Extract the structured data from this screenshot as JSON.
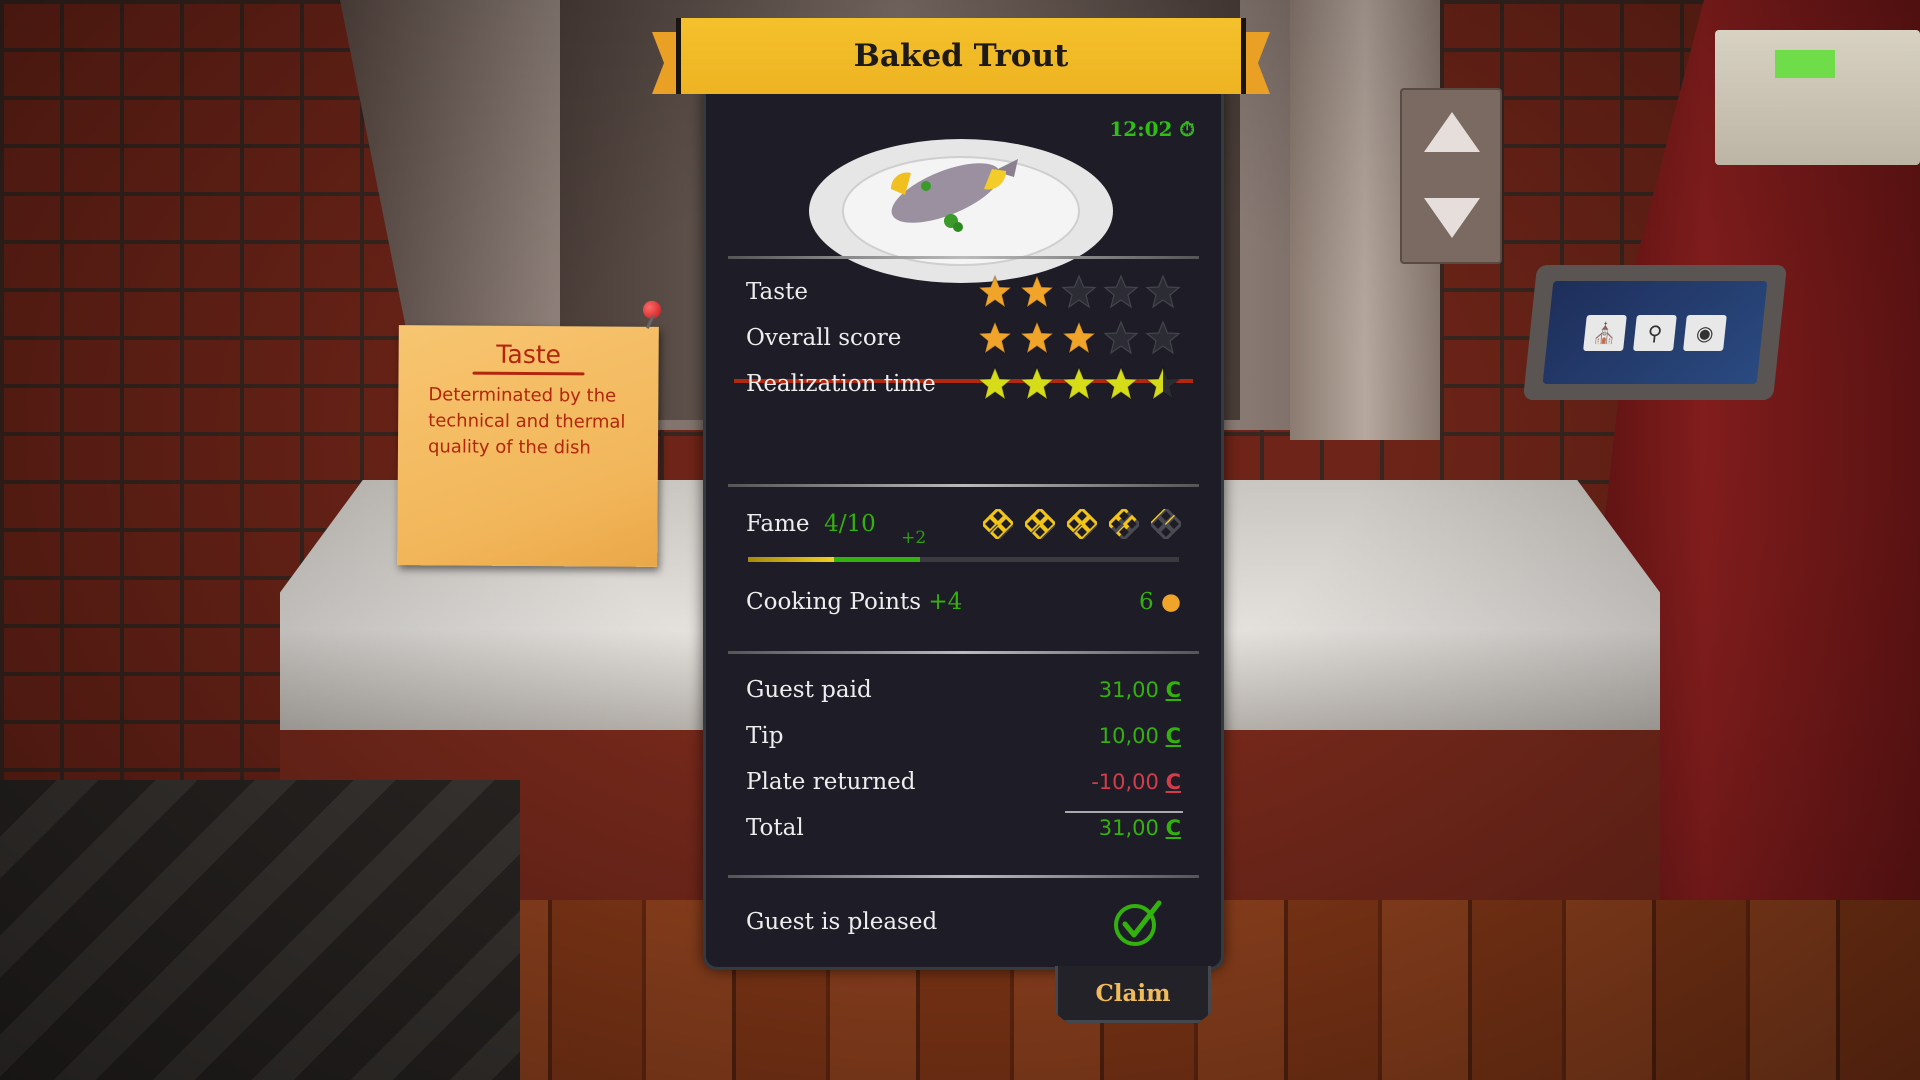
{
  "dish": {
    "title": "Baked Trout",
    "timer": "12:02",
    "timer_icon": "stopwatch-icon",
    "image": "plate-with-baked-trout"
  },
  "ratings": [
    {
      "label": "Taste",
      "stars": 2,
      "max": 5,
      "color": "#f0a42a",
      "highlighted": true
    },
    {
      "label": "Overall score",
      "stars": 3,
      "max": 5,
      "color": "#f0a42a",
      "highlighted": false
    },
    {
      "label": "Realization time",
      "stars": 4.5,
      "max": 5,
      "color": "#d6dc18",
      "highlighted": false
    }
  ],
  "fame": {
    "label": "Fame",
    "value_text": "4/10",
    "previous": 2,
    "current": 4,
    "max": 10,
    "delta_text": "+2",
    "icons_filled": 3.5,
    "icons_max": 5,
    "icon": "fame-knot-icon"
  },
  "cooking_points": {
    "label": "Cooking Points",
    "delta_text": "+4",
    "total": "6",
    "icon": "chef-hat-icon"
  },
  "payment": {
    "rows": [
      {
        "label": "Guest paid",
        "amount": "31,00",
        "currency": "C",
        "status": "positive"
      },
      {
        "label": "Tip",
        "amount": "10,00",
        "currency": "C",
        "status": "positive"
      },
      {
        "label": "Plate returned",
        "amount": "-10,00",
        "currency": "C",
        "status": "negative"
      },
      {
        "label": "Total",
        "amount": "31,00",
        "currency": "C",
        "status": "positive"
      }
    ]
  },
  "guest_status": {
    "label": "Guest is pleased",
    "icon": "check-circle-icon"
  },
  "claim_label": "Claim",
  "tooltip": {
    "title": "Taste",
    "body": "Determinated by the technical and thermal quality of the dish"
  },
  "colors": {
    "accent_gold": "#f4c12c",
    "positive_green": "#33b10c",
    "negative_red": "#d33c4a",
    "panel_bg": "#1e1d27",
    "claim_text": "#f0bb5a"
  },
  "scene": {
    "elevator_buttons": [
      "up",
      "down"
    ],
    "tablet_apps": [
      "order-app-icon",
      "search-dish-app-icon",
      "camera-app-icon"
    ]
  }
}
